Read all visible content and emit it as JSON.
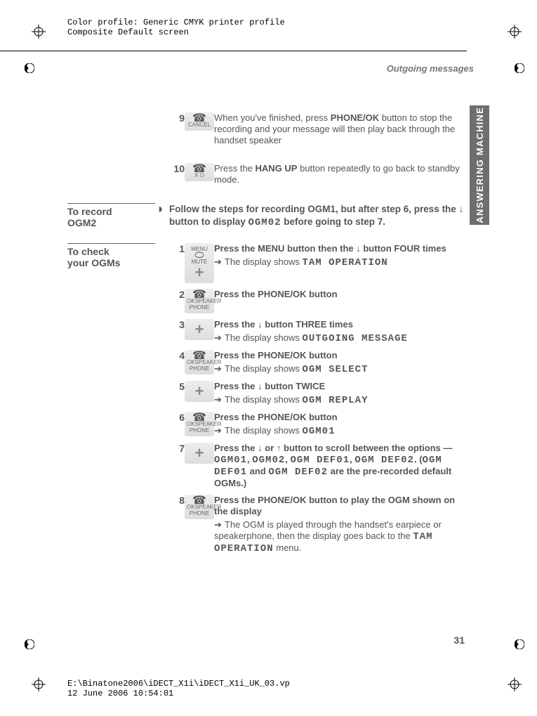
{
  "prepress": {
    "line1": "Color profile: Generic CMYK printer profile",
    "line2": "Composite  Default screen",
    "footer_line1": "E:\\Binatone2006\\iDECT_X1i\\iDECT_X1i_UK_03.vp",
    "footer_line2": "12 June 2006 10:54:01"
  },
  "header_sub": "Outgoing messages",
  "side_tab": "ANSWERING MACHINE",
  "page_number": "31",
  "continued_steps": {
    "s9": {
      "num": "9",
      "icon_label": "CANCEL",
      "text_before": "When you've finished, press ",
      "bold1": "PHONE/OK",
      "text_after": " button to stop the recording and your message will then  play back through the handset  speaker"
    },
    "s10": {
      "num": "10",
      "icon_label": "X  ⏻",
      "text_before": "Press the ",
      "bold1": "HANG UP",
      "text_after": " button repeatedly to go back to standby mode."
    }
  },
  "to_record": {
    "label1": "To record",
    "label2": "OGM2",
    "bullet": "◗",
    "text_before": "Follow the steps for recording OGM1, but after step 6, press the ",
    "arrow": "↓",
    "text_mid": " button to display  ",
    "disp": "OGM02",
    "text_after": " before going to step 7."
  },
  "check": {
    "label1": "To check",
    "label2": "your OGMs",
    "s1": {
      "num": "1",
      "icon": "MENU\nMUTE",
      "line1_before": "Press the ",
      "bold": "MENU",
      "line1_mid": " button then the ",
      "arrow": "↓",
      "line1_after": " button FOUR times",
      "result_before": "The display shows  ",
      "disp": "TAM OPERATION"
    },
    "s2": {
      "num": "2",
      "icon": "OK\nSPEAKER\nPHONE",
      "line1_before": "Press the ",
      "bold": "PHONE/OK",
      "line1_after": " button"
    },
    "s3": {
      "num": "3",
      "icon": "plus",
      "line1_before": "Press the ",
      "arrow": "↓",
      "line1_after": " button THREE times",
      "result_before": "The display shows  ",
      "disp": "OUTGOING MESSAGE"
    },
    "s4": {
      "num": "4",
      "icon": "OK\nSPEAKER\nPHONE",
      "line1_before": "Press the ",
      "bold": "PHONE/OK",
      "line1_after": " button",
      "result_before": "The display shows  ",
      "disp": "OGM  SELECT"
    },
    "s5": {
      "num": "5",
      "icon": "plus",
      "line1_before": "Press the ",
      "arrow": "↓",
      "line1_after": " button TWICE",
      "result_before": "The display shows  ",
      "disp": "OGM  REPLAY"
    },
    "s6": {
      "num": "6",
      "icon": "OK\nSPEAKER\nPHONE",
      "line1_before": "Press the ",
      "bold": "PHONE/OK",
      "line1_after": " button",
      "result_before": "The display shows  ",
      "disp": "OGM01"
    },
    "s7": {
      "num": "7",
      "icon": "plus",
      "line1_before": "Press the ",
      "arrow1": "↓",
      "mid1": " or ",
      "arrow2": "↑",
      "line1_after": " button to scroll between the options — ",
      "d1": "OGM01",
      "c1": ", ",
      "d2": "OGM02",
      "c2": ", ",
      "d3": "OGM DEF01",
      "c3": ", ",
      "d4": "OGM DEF02",
      "c4": ". (",
      "d5": "OGM DEF01",
      "c5": " and  ",
      "d6": "OGM  DEF02",
      "c6": " are the pre-recorded default OGMs.)"
    },
    "s8": {
      "num": "8",
      "icon": "OK\nSPEAKER\nPHONE",
      "line1_before": "Press the ",
      "bold": "PHONE/OK",
      "line1_after": " button to play the OGM shown on the display",
      "result_before": "The OGM is played through the handset's earpiece or speakerphone, then the display goes back to the  ",
      "disp": "TAM OPERATION",
      "result_after": " menu."
    }
  }
}
